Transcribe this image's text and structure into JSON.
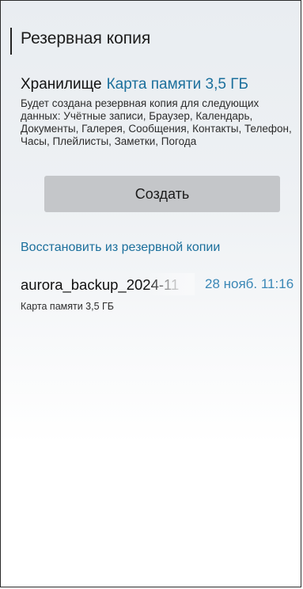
{
  "header": {
    "title": "Резервная копия"
  },
  "storage": {
    "label": "Хранилище",
    "value": "Карта памяти 3,5 ГБ",
    "description": "Будет создана резервная копия для следующих данных: Учётные записи, Браузер, Календарь, Документы, Галерея, Сообщения, Контакты, Телефон, Часы, Плейлисты, Заметки, Погода"
  },
  "actions": {
    "create_label": "Создать"
  },
  "restore": {
    "title": "Восстановить из резервной копии",
    "items": [
      {
        "name": "aurora_backup_2024-11",
        "date": "28 нояб. 11:16",
        "storage": "Карта памяти 3,5 ГБ"
      }
    ]
  },
  "colors": {
    "accent": "#1b6f9c",
    "date": "#3a87b6",
    "button_bg": "#c4c6c9",
    "background_top": "#e9edf1"
  }
}
